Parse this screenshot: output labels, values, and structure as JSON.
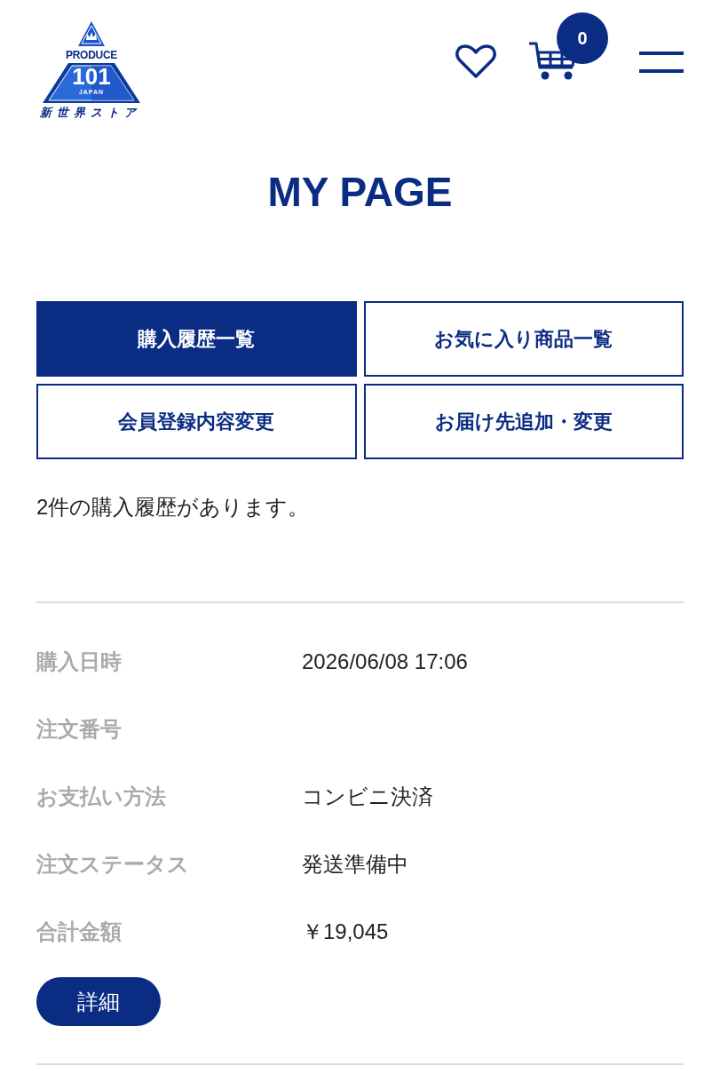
{
  "header": {
    "logo": {
      "wordmark": "PRODUCE",
      "number": "101",
      "country": "JAPAN",
      "store_name": "新世界ストア"
    },
    "cart_count": "0"
  },
  "title": "MY PAGE",
  "tabs": [
    {
      "label": "購入履歴一覧",
      "selected": true
    },
    {
      "label": "お気に入り商品一覧",
      "selected": false
    },
    {
      "label": "会員登録内容変更",
      "selected": false
    },
    {
      "label": "お届け先追加・変更",
      "selected": false
    }
  ],
  "summary": "2件の購入履歴があります。",
  "orders": [
    {
      "fields": [
        {
          "label": "購入日時",
          "value": "2026/06/08 17:06"
        },
        {
          "label": "注文番号"
        },
        {
          "label": "お支払い方法",
          "value": "コンビニ決済"
        },
        {
          "label": "注文ステータス",
          "value": "発送準備中"
        },
        {
          "label": "合計金額",
          "value": "￥19,045"
        }
      ],
      "button": "詳細"
    }
  ]
}
